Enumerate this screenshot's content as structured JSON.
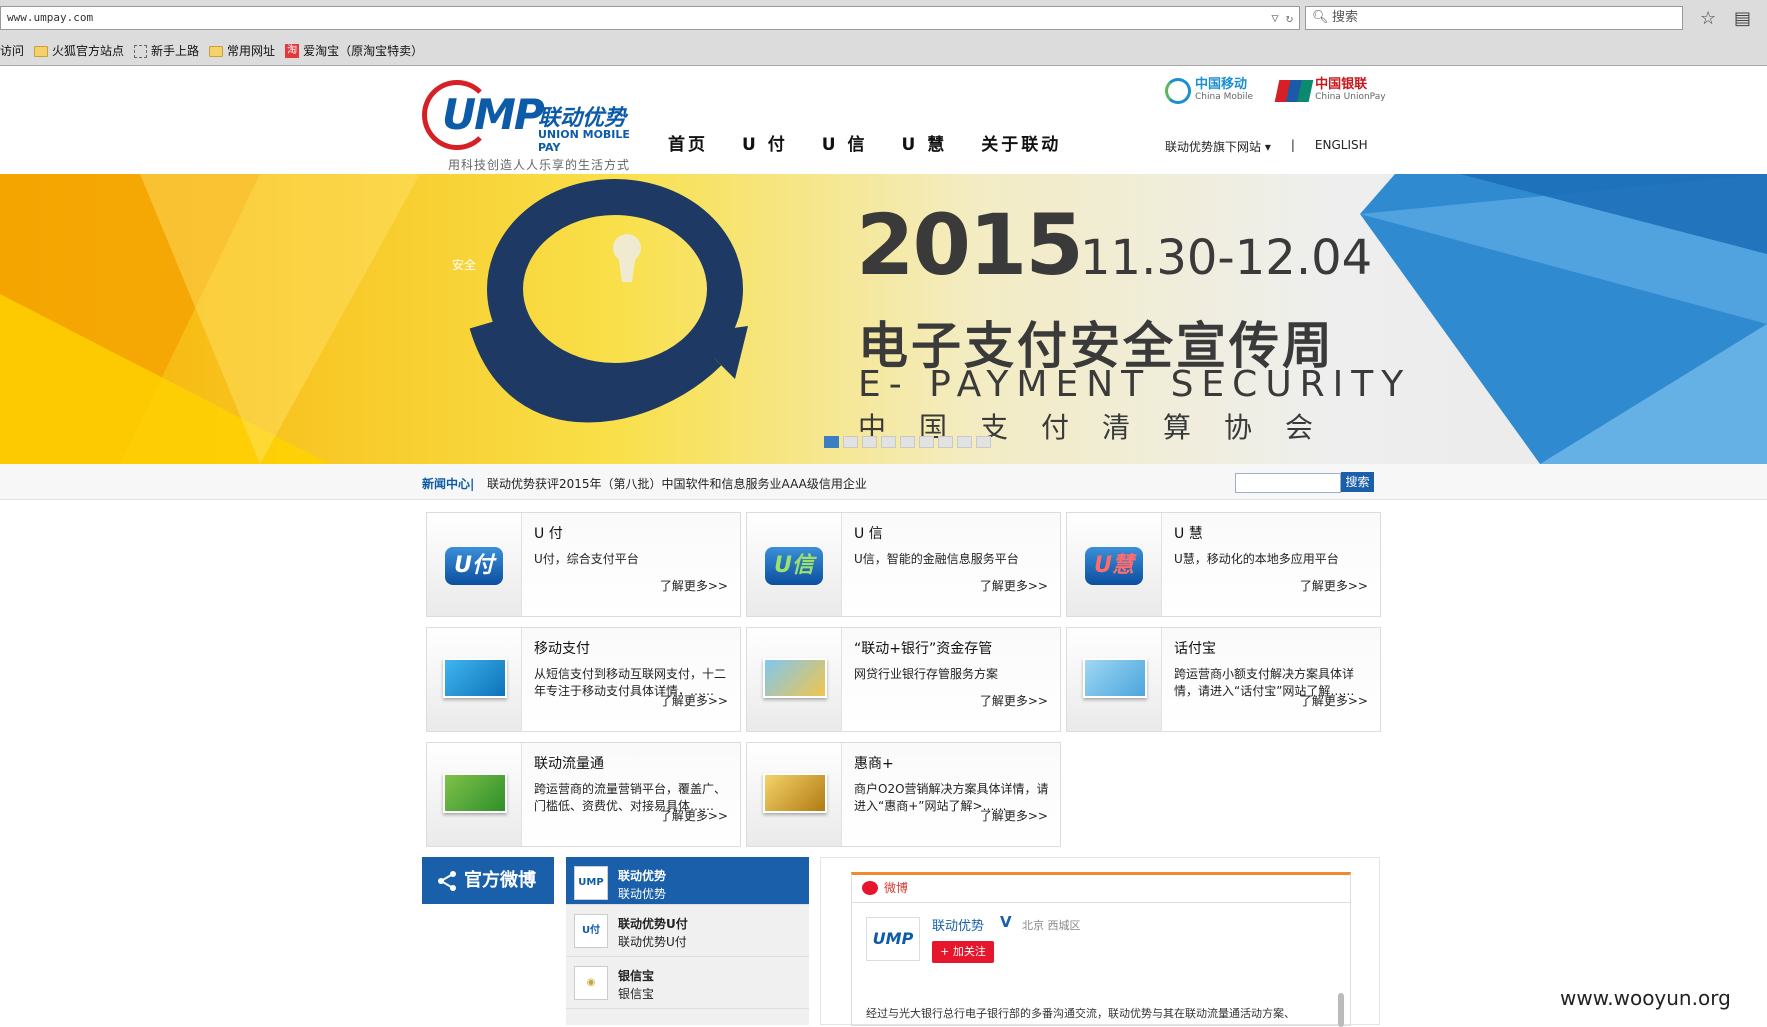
{
  "browser": {
    "url": "www.umpay.com",
    "search_placeholder": "搜索",
    "bookmarks": [
      {
        "label": "访问",
        "icon": "none"
      },
      {
        "label": "火狐官方站点",
        "icon": "folder-icon"
      },
      {
        "label": "新手上路",
        "icon": "page-icon"
      },
      {
        "label": "常用网址",
        "icon": "folder-icon"
      },
      {
        "label": "爱淘宝（原淘宝特卖）",
        "icon": "taobao-icon",
        "badge": "淘"
      }
    ]
  },
  "header": {
    "logo_main": "UMP",
    "logo_cn": "联动优势",
    "logo_en": "UNION MOBILE PAY",
    "slogan": "用科技创造人人乐享的生活方式",
    "nav": [
      "首页",
      "U 付",
      "U 信",
      "U 慧",
      "关于联动"
    ],
    "partners": [
      {
        "cn": "中国移动",
        "en": "China Mobile"
      },
      {
        "cn": "中国银联",
        "en": "China UnionPay"
      }
    ],
    "sites_dropdown": "联动优势旗下网站",
    "sep": "|",
    "english_link": "ENGLISH"
  },
  "banner": {
    "year": "2015",
    "dates": "11.30-12.04",
    "title": "电子支付安全宣传周",
    "subtitle_en": "E- PAYMENT SECURITY",
    "org": "中国支付清算协会",
    "small_text": "安全",
    "slide_count": 9,
    "active_slide": 1,
    "colors": {
      "yellow": "#f7b500",
      "blue": "#2f8ad0",
      "navy": "#1e3a64"
    }
  },
  "news": {
    "label": "新闻中心|",
    "headline": "联动优势获评2015年（第八批）中国软件和信息服务业AAA级信用企业",
    "search_button": "搜索"
  },
  "products": [
    {
      "title": "U 付",
      "desc": "U付，综合支付平台",
      "more": "了解更多>>",
      "icon": "u-fu-icon",
      "badge": "U付"
    },
    {
      "title": "U 信",
      "desc": "U信，智能的金融信息服务平台",
      "more": "了解更多>>",
      "icon": "u-xin-icon",
      "badge": "U信"
    },
    {
      "title": "U 慧",
      "desc": "U慧，移动化的本地多应用平台",
      "more": "了解更多>>",
      "icon": "u-hui-icon",
      "badge": "U慧"
    },
    {
      "title": "移动支付",
      "desc": "从短信支付到移动互联网支付，十二年专注于移动支付具体详情，……",
      "more": "了解更多>>",
      "icon": "mobile-payment-thumb"
    },
    {
      "title": "“联动+银行”资金存管",
      "desc": "网贷行业银行存管服务方案",
      "more": "了解更多>>",
      "icon": "bank-custody-thumb"
    },
    {
      "title": "话付宝",
      "desc": "跨运营商小额支付解决方案具体详情，请进入“话付宝”网站了解……",
      "more": "了解更多>>",
      "icon": "huafubao-thumb"
    },
    {
      "title": "联动流量通",
      "desc": "跨运营商的流量营销平台，覆盖广、门槛低、资费优、对接易具体……",
      "more": "了解更多>>",
      "icon": "traffic-4g-thumb"
    },
    {
      "title": "惠商+",
      "desc": "商户O2O营销解决方案具体详情，请进入“惠商+”网站了解>……",
      "more": "了解更多>>",
      "icon": "huishang-thumb"
    }
  ],
  "weibo": {
    "tab_label": "官方微博",
    "list": [
      {
        "name": "联动优势",
        "sub": "联动优势",
        "avatar": "UMP"
      },
      {
        "name": "联动优势U付",
        "sub": "联动优势U付",
        "avatar": "U付"
      },
      {
        "name": "银信宝",
        "sub": "银信宝",
        "avatar": "◉"
      }
    ],
    "widget_title": "微博",
    "account_name": "联动优势",
    "verified_mark": "V",
    "location": "北京 西城区",
    "follow_button": "+ 加关注",
    "avatar_text": "UMP",
    "post_text": "经过与光大银行总行电子银行部的多番沟通交流，联动优势与其在联动流量通活动方案、"
  },
  "watermark": "www.wooyun.org"
}
